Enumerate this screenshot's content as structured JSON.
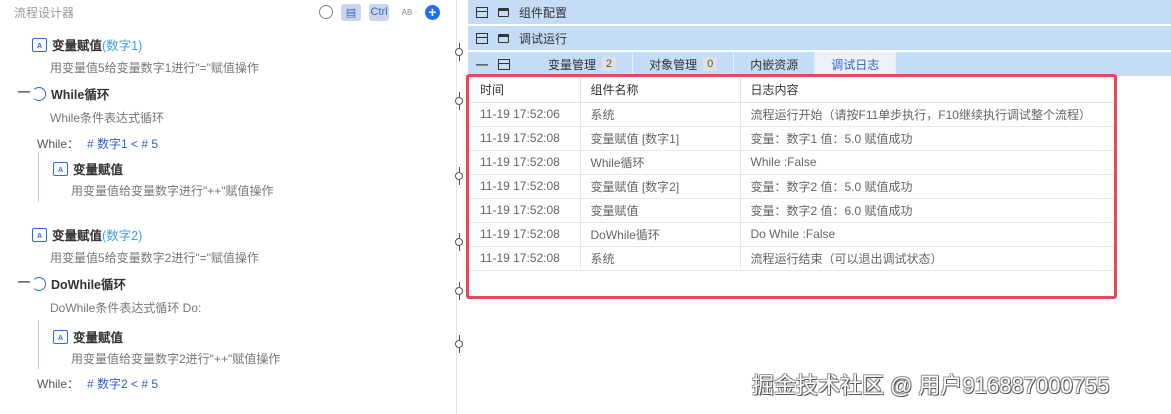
{
  "left": {
    "title": "流程设计器",
    "toolbar": {
      "ctrl": "Ctrl",
      "ab": "AB"
    },
    "nodes": [
      {
        "name": "变量赋值",
        "tag": "(数字1)",
        "desc": "用变量值5给变量数字1进行\"=\"赋值操作"
      },
      {
        "name": "While循环",
        "desc": "While条件表达式循环",
        "cond_label": "While：",
        "cond": "# 数字1 < # 5"
      },
      {
        "name": "变量赋值",
        "desc": "用变量值给变量数字进行\"++\"赋值操作"
      },
      {
        "name": "变量赋值",
        "tag": "(数字2)",
        "desc": "用变量值5给变量数字2进行\"=\"赋值操作"
      },
      {
        "name": "DoWhile循环",
        "desc": "DoWhile条件表达式循环 Do:",
        "cond_label": "While：",
        "cond": "# 数字2 < # 5"
      },
      {
        "name": "变量赋值",
        "desc": "用变量值给变量数字2进行\"++\"赋值操作"
      }
    ]
  },
  "right": {
    "bars": [
      "组件配置",
      "调试运行"
    ],
    "tabs": [
      {
        "label": "变量管理",
        "count": "2"
      },
      {
        "label": "对象管理",
        "count": "0"
      },
      {
        "label": "内嵌资源"
      },
      {
        "label": "调试日志"
      }
    ],
    "log": {
      "columns": [
        "时间",
        "组件名称",
        "日志内容"
      ],
      "rows": [
        [
          "11-19 17:52:06",
          "系统",
          "流程运行开始（请按F11单步执行，F10继续执行调试整个流程）"
        ],
        [
          "11-19 17:52:08",
          "变量赋值 [数字1]",
          "变量：数字1 值：5.0 赋值成功"
        ],
        [
          "11-19 17:52:08",
          "While循环",
          "While :False"
        ],
        [
          "11-19 17:52:08",
          "变量赋值 [数字2]",
          "变量：数字2 值：5.0 赋值成功"
        ],
        [
          "11-19 17:52:08",
          "变量赋值",
          "变量：数字2 值：6.0 赋值成功"
        ],
        [
          "11-19 17:52:08",
          "DoWhile循环",
          "Do While :False"
        ],
        [
          "11-19 17:52:08",
          "系统",
          "流程运行结束（可以退出调试状态）"
        ]
      ]
    }
  },
  "watermark": "掘金技术社区 @ 用户9168870007​55",
  "colors": {
    "accent": "#2b5fd9",
    "bar": "#c5dcf7",
    "highlight": "#e8475c"
  }
}
